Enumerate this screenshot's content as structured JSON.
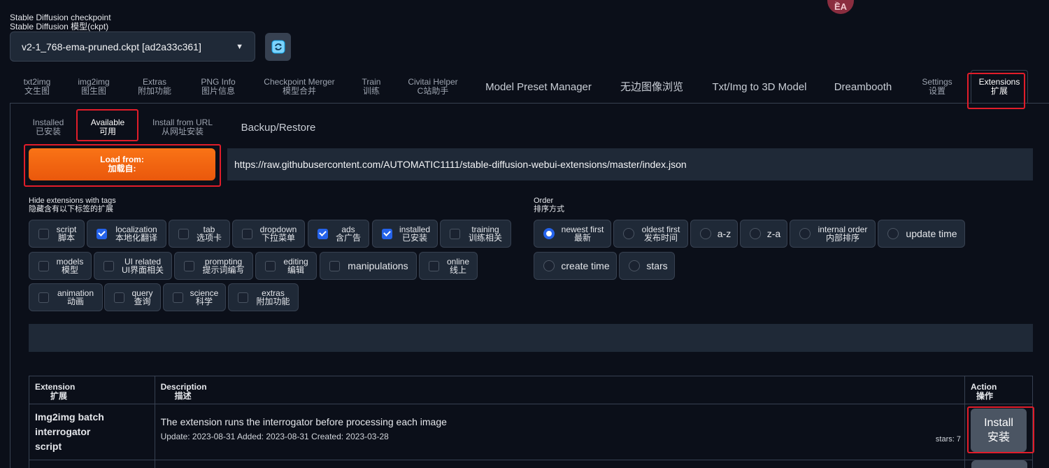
{
  "checkpoint": {
    "label_en": "Stable Diffusion checkpoint",
    "label_zh": "Stable Diffusion 模型(ckpt)",
    "value": "v2-1_768-ema-pruned.ckpt [ad2a33c361]",
    "refresh_icon": "refresh-icon"
  },
  "avatar_text": "ỀA",
  "main_tabs": [
    {
      "en": "txt2img",
      "zh": "文生图"
    },
    {
      "en": "img2img",
      "zh": "图生图"
    },
    {
      "en": "Extras",
      "zh": "附加功能"
    },
    {
      "en": "PNG Info",
      "zh": "图片信息"
    },
    {
      "en": "Checkpoint Merger",
      "zh": "模型合并"
    },
    {
      "en": "Train",
      "zh": "训练"
    },
    {
      "en": "Civitai Helper",
      "zh": "C站助手"
    },
    {
      "en": "Model Preset Manager"
    },
    {
      "en": "无边图像浏览"
    },
    {
      "en": "Txt/Img to 3D Model"
    },
    {
      "en": "Dreambooth"
    },
    {
      "en": "Settings",
      "zh": "设置"
    },
    {
      "en": "Extensions",
      "zh": "扩展"
    }
  ],
  "sub_tabs": [
    {
      "en": "Installed",
      "zh": "已安装"
    },
    {
      "en": "Available",
      "zh": "可用"
    },
    {
      "en": "Install from URL",
      "zh": "从网址安装"
    },
    {
      "en": "Backup/Restore"
    }
  ],
  "load": {
    "label_en": "Load from:",
    "label_zh": "加载自:",
    "url": "https://raw.githubusercontent.com/AUTOMATIC1111/stable-diffusion-webui-extensions/master/index.json"
  },
  "hide_tags": {
    "label_en": "Hide extensions with tags",
    "label_zh": "隐藏含有以下标签的扩展",
    "items": [
      {
        "en": "script",
        "zh": "脚本",
        "checked": false
      },
      {
        "en": "localization",
        "zh": "本地化翻译",
        "checked": true
      },
      {
        "en": "tab",
        "zh": "选项卡",
        "checked": false
      },
      {
        "en": "dropdown",
        "zh": "下拉菜单",
        "checked": false
      },
      {
        "en": "ads",
        "zh": "含广告",
        "checked": true
      },
      {
        "en": "installed",
        "zh": "已安装",
        "checked": true
      },
      {
        "en": "training",
        "zh": "训练相关",
        "checked": false
      },
      {
        "en": "models",
        "zh": "模型",
        "checked": false
      },
      {
        "en": "UI related",
        "zh": "UI界面相关",
        "checked": false
      },
      {
        "en": "prompting",
        "zh": "提示词编写",
        "checked": false
      },
      {
        "en": "editing",
        "zh": "编辑",
        "checked": false
      },
      {
        "en": "manipulations",
        "checked": false
      },
      {
        "en": "online",
        "zh": "线上",
        "checked": false
      },
      {
        "en": "animation",
        "zh": "动画",
        "checked": false
      },
      {
        "en": "query",
        "zh": "查询",
        "checked": false
      },
      {
        "en": "science",
        "zh": "科学",
        "checked": false
      },
      {
        "en": "extras",
        "zh": "附加功能",
        "checked": false
      }
    ]
  },
  "order": {
    "label_en": "Order",
    "label_zh": "排序方式",
    "selected": "newest first",
    "items": [
      {
        "en": "newest first",
        "zh": "最新"
      },
      {
        "en": "oldest first",
        "zh": "发布时间"
      },
      {
        "en": "a-z"
      },
      {
        "en": "z-a"
      },
      {
        "en": "internal order",
        "zh": "内部排序"
      },
      {
        "en": "update time"
      },
      {
        "en": "create time"
      },
      {
        "en": "stars"
      }
    ]
  },
  "table": {
    "headers": [
      {
        "en": "Extension",
        "zh": "扩展"
      },
      {
        "en": "Description",
        "zh": "描述"
      },
      {
        "en": "Action",
        "zh": "操作"
      }
    ],
    "rows": [
      {
        "name_lines": [
          "Img2img batch",
          "interrogator",
          "script"
        ],
        "description": "The extension runs the interrogator before processing each image",
        "meta": "Update: 2023-08-31 Added: 2023-08-31 Created: 2023-03-28",
        "stars": "stars: 7",
        "action_en": "Install",
        "action_zh": "安装"
      }
    ]
  },
  "colors": {
    "background": "#0b0f19",
    "accent_orange": "#f97316",
    "checkbox_blue": "#2563eb",
    "highlight_red": "#e11d2a"
  }
}
